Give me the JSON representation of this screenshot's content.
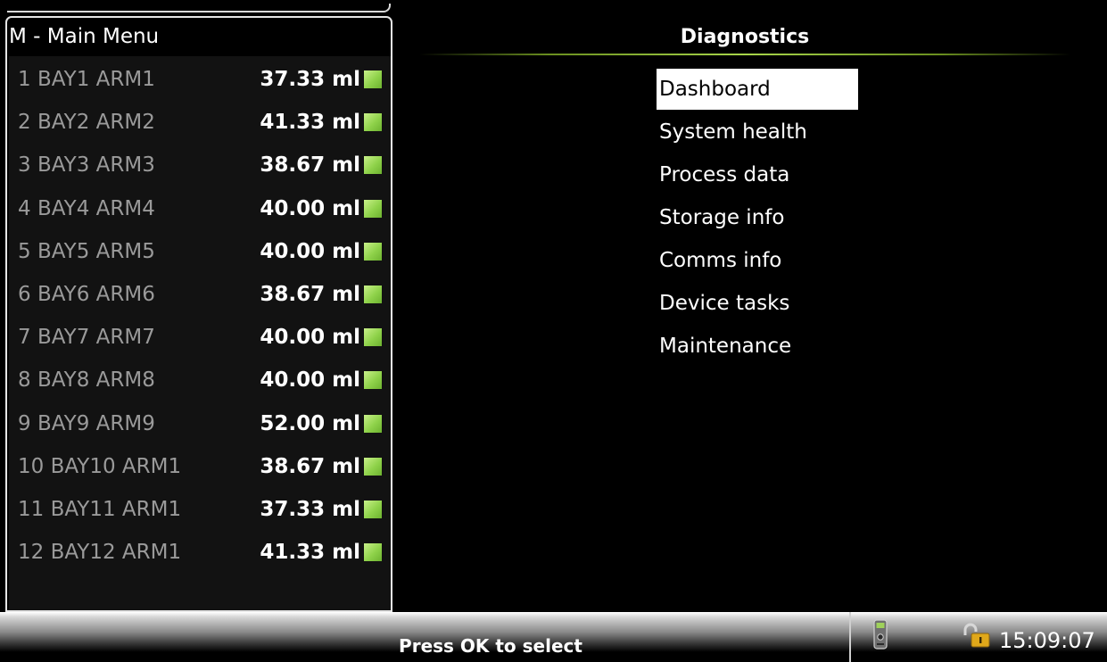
{
  "main_menu": {
    "title": "M - Main Menu",
    "items": [
      {
        "label": "1   BAY1 ARM1",
        "value": "37.33 ml"
      },
      {
        "label": "2   BAY2 ARM2",
        "value": "41.33 ml"
      },
      {
        "label": "3   BAY3 ARM3",
        "value": "38.67 ml"
      },
      {
        "label": "4   BAY4 ARM4",
        "value": "40.00 ml"
      },
      {
        "label": "5   BAY5 ARM5",
        "value": "40.00 ml"
      },
      {
        "label": "6   BAY6 ARM6",
        "value": "38.67 ml"
      },
      {
        "label": "7   BAY7 ARM7",
        "value": "40.00 ml"
      },
      {
        "label": "8   BAY8 ARM8",
        "value": "40.00 ml"
      },
      {
        "label": "9   BAY9 ARM9",
        "value": "52.00 ml"
      },
      {
        "label": "10 BAY10 ARM1",
        "value": "38.67 ml"
      },
      {
        "label": "11 BAY11 ARM1",
        "value": "37.33 ml"
      },
      {
        "label": "12 BAY12 ARM1",
        "value": "41.33 ml"
      }
    ],
    "status_color": "#8fd24a"
  },
  "diagnostics": {
    "title": "Diagnostics",
    "selected_index": 0,
    "items": [
      "Dashboard",
      "System health",
      "Process data",
      "Storage info",
      "Comms info",
      "Device tasks",
      "Maintenance"
    ]
  },
  "footer": {
    "prompt": "Press OK to select",
    "device_icon": "handheld-device-icon",
    "lock_icon": "padlock-unlocked-icon",
    "time": "15:09:07"
  }
}
